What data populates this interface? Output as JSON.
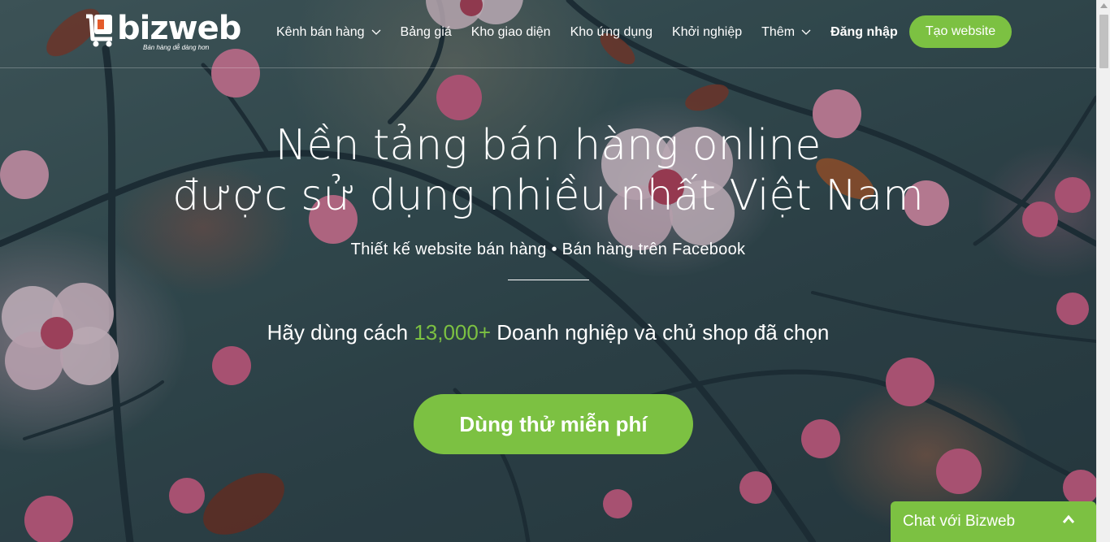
{
  "logo": {
    "name": "bizweb",
    "tagline": "Bán hàng dễ dàng hơn"
  },
  "nav": {
    "items": [
      {
        "label": "Kênh bán hàng",
        "has_dropdown": true
      },
      {
        "label": "Bảng giá",
        "has_dropdown": false
      },
      {
        "label": "Kho giao diện",
        "has_dropdown": false
      },
      {
        "label": "Kho ứng dụng",
        "has_dropdown": false
      },
      {
        "label": "Khởi nghiệp",
        "has_dropdown": false
      },
      {
        "label": "Thêm",
        "has_dropdown": true
      }
    ],
    "login": "Đăng nhập",
    "cta": "Tạo website"
  },
  "hero": {
    "headline_line1": "Nền tảng bán hàng online",
    "headline_line2": "được sử dụng nhiều nhất Việt Nam",
    "subtitle": "Thiết kế website bán hàng • Bán hàng trên Facebook",
    "pitch_before": "Hãy dùng cách ",
    "pitch_highlight": "13,000+",
    "pitch_after": " Doanh nghiệp và chủ shop đã chọn",
    "cta": "Dùng thử miễn phí"
  },
  "chat": {
    "label": "Chat với Bizweb"
  },
  "colors": {
    "accent": "#7cc142",
    "text": "#ffffff"
  }
}
